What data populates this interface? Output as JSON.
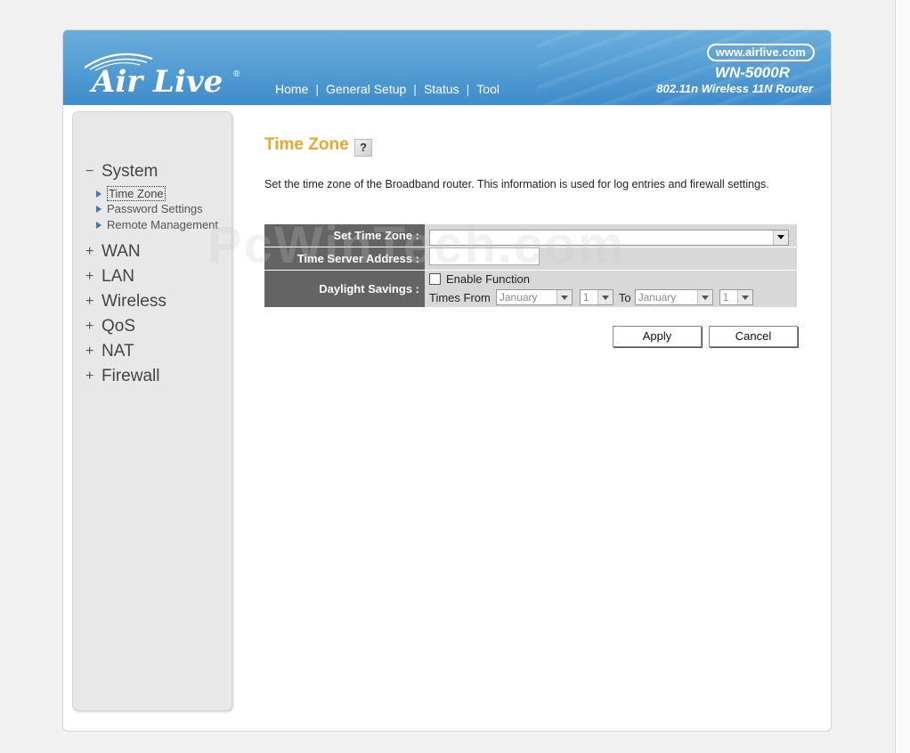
{
  "header": {
    "logo_text": "Air Live",
    "logo_reg": "®",
    "nav": [
      "Home",
      "General Setup",
      "Status",
      "Tool"
    ],
    "url": "www.airlive.com",
    "model": "WN-5000R",
    "model_desc": "802.11n Wireless 11N Router"
  },
  "sidebar": {
    "system": "System",
    "system_sym": "−",
    "sub_items": [
      "Time Zone",
      "Password Settings",
      "Remote Management"
    ],
    "groups": [
      "WAN",
      "LAN",
      "Wireless",
      "QoS",
      "NAT",
      "Firewall"
    ],
    "group_sym": "+"
  },
  "main": {
    "title": "Time Zone",
    "help_glyph": "?",
    "description": "Set the time zone of the Broadband router. This information is used for log entries and firewall settings.",
    "set_time_zone_label": "Set Time Zone :",
    "set_time_zone_value": "",
    "time_server_label": "Time Server Address :",
    "time_server_value": "",
    "daylight_label": "Daylight Savings :",
    "enable_function": "Enable Function",
    "times_from": "Times From",
    "from_month": "January",
    "from_day": "1",
    "to_label": "To",
    "to_month": "January",
    "to_day": "1",
    "apply": "Apply",
    "cancel": "Cancel"
  },
  "watermark": "PcWinTech.com"
}
